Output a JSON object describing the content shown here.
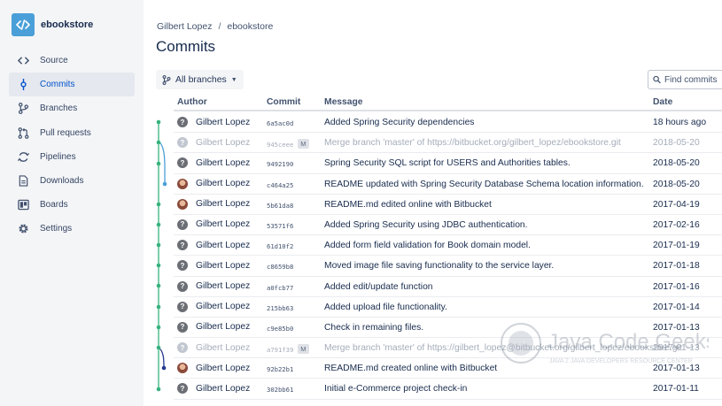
{
  "repo": {
    "name": "ebookstore"
  },
  "sidebar": {
    "items": [
      {
        "label": "Source",
        "icon": "source-code-icon"
      },
      {
        "label": "Commits",
        "icon": "commit-icon",
        "active": true
      },
      {
        "label": "Branches",
        "icon": "branch-icon"
      },
      {
        "label": "Pull requests",
        "icon": "pull-request-icon"
      },
      {
        "label": "Pipelines",
        "icon": "pipelines-icon"
      },
      {
        "label": "Downloads",
        "icon": "downloads-icon"
      },
      {
        "label": "Boards",
        "icon": "boards-icon"
      },
      {
        "label": "Settings",
        "icon": "gear-icon"
      }
    ]
  },
  "breadcrumb": {
    "user": "Gilbert Lopez",
    "separator": "/",
    "repo": "ebookstore"
  },
  "page": {
    "title": "Commits"
  },
  "toolbar": {
    "branch_label": "All branches",
    "search_placeholder": "Find commits"
  },
  "table": {
    "headers": {
      "author": "Author",
      "commit": "Commit",
      "message": "Message",
      "date": "Date"
    },
    "rows": [
      {
        "author": "Gilbert Lopez",
        "avatar": "default",
        "hash": "6a5ac0d",
        "message": "Added Spring Security dependencies",
        "date": "18 hours ago",
        "merge": false
      },
      {
        "author": "Gilbert Lopez",
        "avatar": "default",
        "hash": "945ceee",
        "badge": "M",
        "message": "Merge branch 'master' of https://bitbucket.org/gilbert_lopez/ebookstore.git",
        "date": "2018-05-20",
        "merge": true
      },
      {
        "author": "Gilbert Lopez",
        "avatar": "default",
        "hash": "9492190",
        "message": "Spring Security SQL script for USERS and Authorities tables.",
        "date": "2018-05-20",
        "merge": false
      },
      {
        "author": "Gilbert Lopez",
        "avatar": "photo",
        "hash": "c464a25",
        "message": "README updated with Spring Security Database Schema location information.",
        "date": "2018-05-20",
        "merge": false
      },
      {
        "author": "Gilbert Lopez",
        "avatar": "photo",
        "hash": "5b61da8",
        "message": "README.md edited online with Bitbucket",
        "date": "2017-04-19",
        "merge": false
      },
      {
        "author": "Gilbert Lopez",
        "avatar": "default",
        "hash": "53571f6",
        "message": "Added Spring Security using JDBC authentication.",
        "date": "2017-02-16",
        "merge": false
      },
      {
        "author": "Gilbert Lopez",
        "avatar": "default",
        "hash": "61d10f2",
        "message": "Added form field validation for Book domain model.",
        "date": "2017-01-19",
        "merge": false
      },
      {
        "author": "Gilbert Lopez",
        "avatar": "default",
        "hash": "c8659b8",
        "message": "Moved image file saving functionality to the service layer.",
        "date": "2017-01-18",
        "merge": false
      },
      {
        "author": "Gilbert Lopez",
        "avatar": "default",
        "hash": "a0fcb77",
        "message": "Added edit/update function",
        "date": "2017-01-16",
        "merge": false
      },
      {
        "author": "Gilbert Lopez",
        "avatar": "default",
        "hash": "215bb63",
        "message": "Added upload file functionality.",
        "date": "2017-01-14",
        "merge": false
      },
      {
        "author": "Gilbert Lopez",
        "avatar": "default",
        "hash": "c9e85b0",
        "message": "Check in remaining files.",
        "date": "2017-01-13",
        "merge": false
      },
      {
        "author": "Gilbert Lopez",
        "avatar": "default",
        "hash": "a791f39",
        "badge": "M",
        "message": "Merge branch 'master' of https://gilbert_lopez@bitbucket.org/gilbert_lopez/ebookstore.git",
        "date": "2017-01-13",
        "merge": true
      },
      {
        "author": "Gilbert Lopez",
        "avatar": "photo",
        "hash": "92b22b1",
        "message": "README.md created online with Bitbucket",
        "date": "2017-01-13",
        "merge": false
      },
      {
        "author": "Gilbert Lopez",
        "avatar": "default",
        "hash": "302bb61",
        "message": "Initial e-Commerce project check-in",
        "date": "2017-01-11",
        "merge": false
      }
    ]
  },
  "watermark": {
    "brand": "Java Code Geeks",
    "tagline": "JAVA 2 JAVA DEVELOPERS RESOURCE CENTER"
  },
  "colors": {
    "accent": "#0052cc",
    "graph_main": "#36b37e",
    "graph_branch": "#4a9fd8",
    "graph_merge": "#253a8f",
    "sidebar_bg": "#f4f5f7"
  }
}
